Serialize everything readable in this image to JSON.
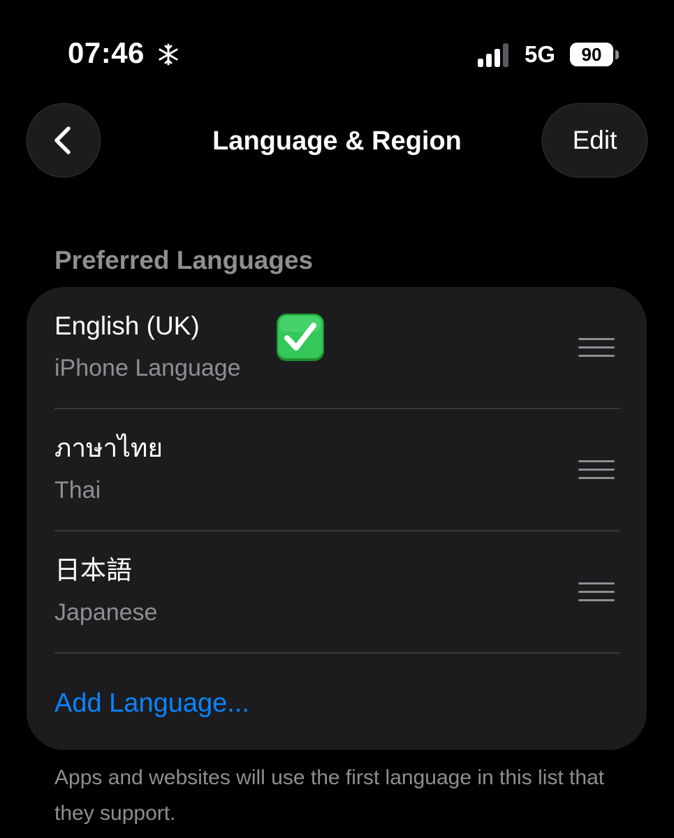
{
  "status_bar": {
    "time": "07:46",
    "network": "5G",
    "battery_level": "90",
    "focus_icon": "snowflake-icon",
    "signal_icon": "cellular-signal-icon"
  },
  "nav": {
    "title": "Language & Region",
    "edit_label": "Edit",
    "back_icon": "chevron-left-icon"
  },
  "preferred_languages": {
    "header": "Preferred Languages",
    "items": [
      {
        "name": "English (UK)",
        "subtitle": "iPhone Language",
        "badge_icon": "green-checkmark-icon"
      },
      {
        "name": "ภาษาไทย",
        "subtitle": "Thai"
      },
      {
        "name": "日本語",
        "subtitle": "Japanese"
      }
    ],
    "add_label": "Add Language...",
    "footer": "Apps and websites will use the first language in this list that they support."
  },
  "colors": {
    "background": "#000000",
    "group_background": "#1c1c1e",
    "secondary_text": "#8e8e93",
    "separator": "#38383a",
    "link": "#0a84ff",
    "checkmark_green": "#34c759"
  }
}
